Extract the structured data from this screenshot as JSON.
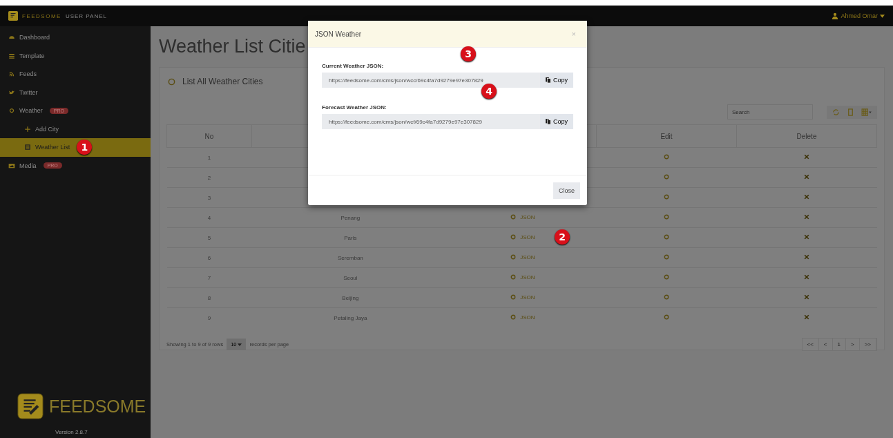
{
  "topbar": {
    "brand": "FEEDSOME",
    "subtitle": "USER PANEL",
    "user": "Ahmed Omar"
  },
  "sidebar": {
    "items": [
      {
        "label": "Dashboard",
        "selected": false
      },
      {
        "label": "Template",
        "selected": false
      },
      {
        "label": "Feeds",
        "selected": false
      },
      {
        "label": "Twitter",
        "selected": false
      },
      {
        "label": "Weather",
        "selected": false,
        "badge": "PRO",
        "children": [
          {
            "label": "Add City",
            "selected": false
          },
          {
            "label": "Weather List",
            "selected": true,
            "marker": "1"
          }
        ]
      },
      {
        "label": "Media",
        "selected": false,
        "badge": "PRO"
      }
    ],
    "logo": "FEEDSOME",
    "version": "Version 2.8.7"
  },
  "page": {
    "title": "Weather List Citie"
  },
  "panel": {
    "title": "List All Weather Cities",
    "search": {
      "placeholder": "Search"
    },
    "table": {
      "columns": [
        "No",
        "",
        "",
        "Edit",
        "Delete"
      ],
      "rows": [
        {
          "no": "1"
        },
        {
          "no": "2"
        },
        {
          "no": "3"
        },
        {
          "no": "4",
          "name": "Penang",
          "json": "JSON"
        },
        {
          "no": "5",
          "name": "Paris",
          "json": "JSON",
          "marker": "2"
        },
        {
          "no": "6",
          "name": "Seremban",
          "json": "JSON"
        },
        {
          "no": "7",
          "name": "Seoul",
          "json": "JSON"
        },
        {
          "no": "8",
          "name": "Beijing",
          "json": "JSON"
        },
        {
          "no": "9",
          "name": "Petaling Jaya",
          "json": "JSON"
        }
      ]
    },
    "footer": {
      "showing": "Showing 1 to 9 of 9 rows",
      "per_page": "10",
      "per_page_label": "records per page",
      "pages": [
        "<<",
        "<",
        "1",
        ">",
        ">>"
      ]
    }
  },
  "modal": {
    "title": "JSON Weather",
    "close_x": "×",
    "fields": [
      {
        "label": "Current Weather JSON:",
        "value": "https://feedsome.com/cms/json/wcc/69c4fa7d9279e97e307829",
        "button": "Copy",
        "marker": "3"
      },
      {
        "label": "Forecast Weather JSON:",
        "value": "https://feedsome.com/cms/json/wcf/69c4fa7d9279e97e307829",
        "button": "Copy",
        "marker": "4"
      }
    ],
    "button": "Close"
  }
}
